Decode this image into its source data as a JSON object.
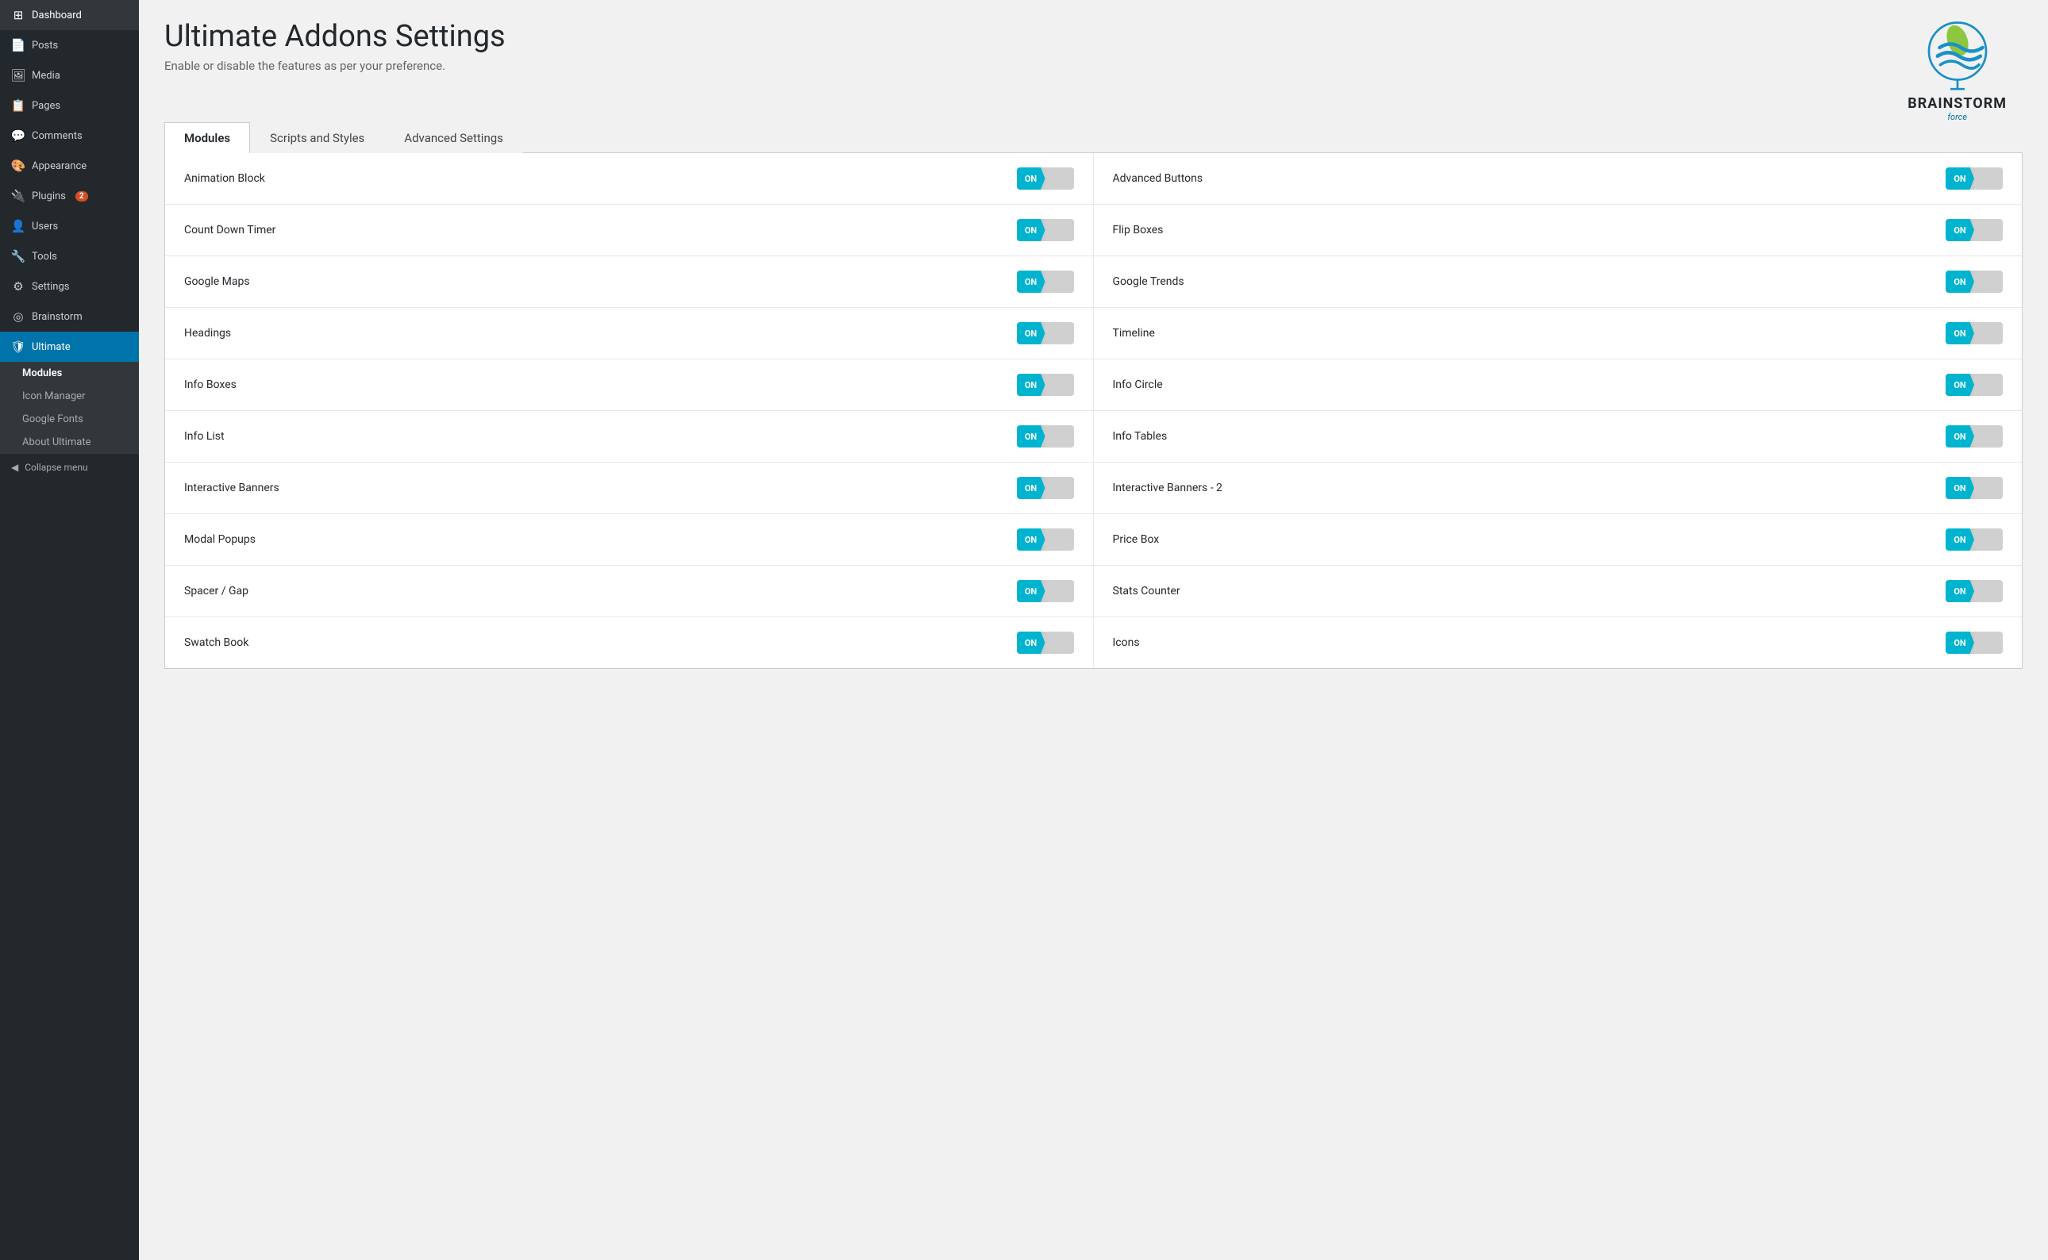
{
  "sidebar": {
    "items": [
      {
        "label": "Dashboard",
        "icon": "⊞",
        "name": "dashboard"
      },
      {
        "label": "Posts",
        "icon": "📄",
        "name": "posts"
      },
      {
        "label": "Media",
        "icon": "🖼",
        "name": "media"
      },
      {
        "label": "Pages",
        "icon": "📋",
        "name": "pages"
      },
      {
        "label": "Comments",
        "icon": "💬",
        "name": "comments"
      },
      {
        "label": "Appearance",
        "icon": "🎨",
        "name": "appearance"
      },
      {
        "label": "Plugins",
        "icon": "🔌",
        "name": "plugins",
        "badge": "2"
      },
      {
        "label": "Users",
        "icon": "👤",
        "name": "users"
      },
      {
        "label": "Tools",
        "icon": "🔧",
        "name": "tools"
      },
      {
        "label": "Settings",
        "icon": "⚙",
        "name": "settings"
      },
      {
        "label": "Brainstorm",
        "icon": "◎",
        "name": "brainstorm"
      },
      {
        "label": "Ultimate",
        "icon": "🛡",
        "name": "ultimate",
        "active": true
      }
    ],
    "submenu": [
      {
        "label": "Modules",
        "name": "modules",
        "active": true
      },
      {
        "label": "Icon Manager",
        "name": "icon-manager"
      },
      {
        "label": "Google Fonts",
        "name": "google-fonts"
      },
      {
        "label": "About Ultimate",
        "name": "about-ultimate"
      }
    ],
    "collapse_label": "Collapse menu"
  },
  "page": {
    "title": "Ultimate Addons Settings",
    "subtitle": "Enable or disable the features as per your preference."
  },
  "logo": {
    "text": "BRAINSTORM",
    "sub": "force"
  },
  "tabs": [
    {
      "label": "Modules",
      "active": true
    },
    {
      "label": "Scripts and Styles",
      "active": false
    },
    {
      "label": "Advanced Settings",
      "active": false
    }
  ],
  "modules": [
    {
      "left_name": "Animation Block",
      "left_on": true,
      "right_name": "Advanced Buttons",
      "right_on": true
    },
    {
      "left_name": "Count Down Timer",
      "left_on": true,
      "right_name": "Flip Boxes",
      "right_on": true
    },
    {
      "left_name": "Google Maps",
      "left_on": true,
      "right_name": "Google Trends",
      "right_on": true
    },
    {
      "left_name": "Headings",
      "left_on": true,
      "right_name": "Timeline",
      "right_on": true
    },
    {
      "left_name": "Info Boxes",
      "left_on": true,
      "right_name": "Info Circle",
      "right_on": true
    },
    {
      "left_name": "Info List",
      "left_on": true,
      "right_name": "Info Tables",
      "right_on": true
    },
    {
      "left_name": "Interactive Banners",
      "left_on": true,
      "right_name": "Interactive Banners - 2",
      "right_on": true
    },
    {
      "left_name": "Modal Popups",
      "left_on": true,
      "right_name": "Price Box",
      "right_on": true
    },
    {
      "left_name": "Spacer / Gap",
      "left_on": true,
      "right_name": "Stats Counter",
      "right_on": true
    },
    {
      "left_name": "Swatch Book",
      "left_on": true,
      "right_name": "Icons",
      "right_on": true
    }
  ],
  "toggle": {
    "on_label": "ON"
  }
}
